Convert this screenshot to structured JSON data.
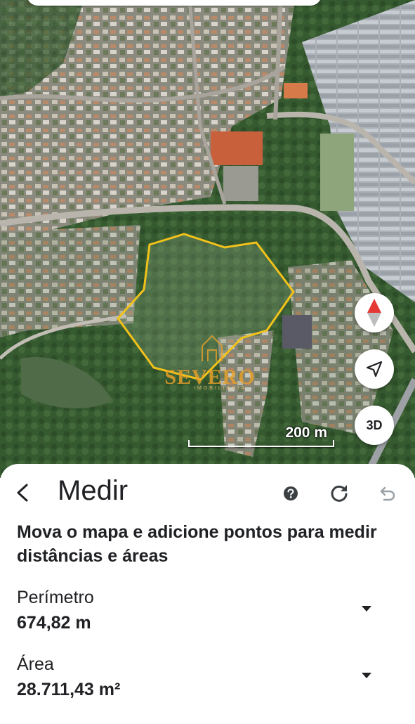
{
  "map": {
    "scale_label": "200 m",
    "view_mode_label": "3D",
    "watermark": {
      "name": "SEVERO",
      "subtitle": "IMOBILIÁRIA"
    },
    "colors": {
      "measure_outline": "#f2c21b",
      "compass_red": "#e53935",
      "compass_gray": "#bdbdbd",
      "watermark": "#e7a02a"
    },
    "icons": {
      "compass": "compass-icon",
      "locate": "navigation-arrow-icon"
    }
  },
  "sheet": {
    "title": "Medir",
    "icons": {
      "back": "back-arrow-icon",
      "help": "help-icon",
      "refresh": "refresh-icon",
      "undo": "undo-icon"
    },
    "instructions": "Mova o mapa e adicione pontos para medir distâncias e áreas",
    "perimeter": {
      "label": "Perímetro",
      "value": "674,82 m"
    },
    "area": {
      "label": "Área",
      "value": "28.711,43 m²"
    }
  }
}
